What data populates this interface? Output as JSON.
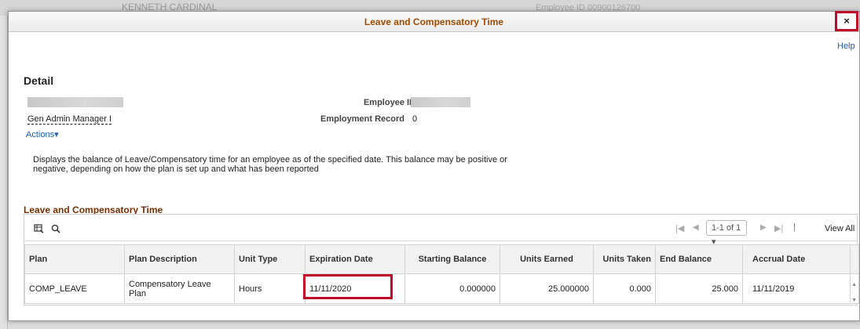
{
  "background": {
    "name_text": "KENNETH CARDINAL",
    "employee_id_text": "Employee ID   00900126700"
  },
  "modal": {
    "title": "Leave and Compensatory Time",
    "close_label": "×",
    "help_label": "Help"
  },
  "detail": {
    "heading": "Detail",
    "job_title": "Gen Admin Manager I",
    "actions_label": "Actions▾",
    "employee_id_label": "Employee ID",
    "employment_record_label": "Employment Record",
    "employment_record_value": "0",
    "description": "Displays the balance of Leave/Compensatory time for an employee as of the specified date. This balance may be positive or negative, depending on how the plan is set up and what has been reported"
  },
  "grid": {
    "title": "Leave and Compensatory Time",
    "toolbar": {
      "personalize_icon": "grid-personalize-icon",
      "search_icon": "search-icon",
      "page_select": "1-1 of 1 ▾",
      "view_all": "View All"
    },
    "columns": [
      "Plan",
      "Plan Description",
      "Unit Type",
      "Expiration Date",
      "Starting Balance",
      "Units Earned",
      "Units Taken",
      "End Balance",
      "Accrual Date"
    ],
    "rows": [
      {
        "plan": "COMP_LEAVE",
        "plan_description": "Compensatory Leave Plan",
        "unit_type": "Hours",
        "expiration_date": "11/11/2020",
        "starting_balance": "0.000000",
        "units_earned": "25.000000",
        "units_taken": "0.000",
        "end_balance": "25.000",
        "accrual_date": "11/11/2019"
      }
    ]
  },
  "colors": {
    "title_orange": "#a44a00",
    "grid_title_brown": "#7a2e00",
    "link_blue": "#1a5fb4",
    "highlight_red": "#c00a28"
  }
}
